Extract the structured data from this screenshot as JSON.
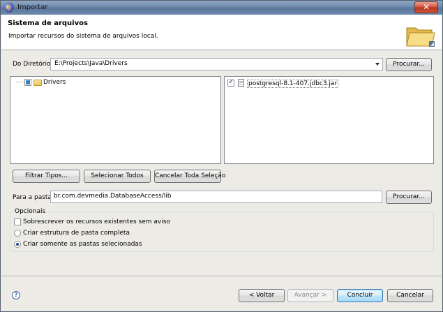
{
  "window": {
    "title": "Importar",
    "close_glyph": "✕",
    "app_icon": "eclipse-icon"
  },
  "header": {
    "title": "Sistema de arquivos",
    "description": "Importar recursos do sistema de arquivos local.",
    "icon": "folder-icon"
  },
  "directory": {
    "label": "Do Diretório:",
    "value": "E:\\Projects\\Java\\Drivers",
    "browse_label": "Procurar..."
  },
  "tree": {
    "items": [
      {
        "label": "Drivers",
        "state": "partial"
      }
    ]
  },
  "files": {
    "items": [
      {
        "label": "postgresql-8.1-407.jdbc3.jar",
        "checked": true
      }
    ]
  },
  "selection_buttons": {
    "filter": "Filtrar Tipos...",
    "select_all": "Selecionar Todos",
    "deselect_all": "Cancelar Toda Seleção"
  },
  "destination": {
    "label": "Para a pasta:",
    "value": "br.com.devmedia.DatabaseAccess/lib",
    "browse_label": "Procurar..."
  },
  "options": {
    "title": "Opcionais",
    "overwrite": "Sobrescrever os recursos existentes sem aviso",
    "overwrite_checked": false,
    "create_full": "Criar estrutura de pasta completa",
    "create_selected": "Criar somente as pastas selecionadas",
    "selected_option": "create_selected"
  },
  "footer": {
    "help_glyph": "?",
    "back": "< Voltar",
    "next": "Avançar >",
    "finish": "Concluir",
    "cancel": "Cancelar"
  }
}
